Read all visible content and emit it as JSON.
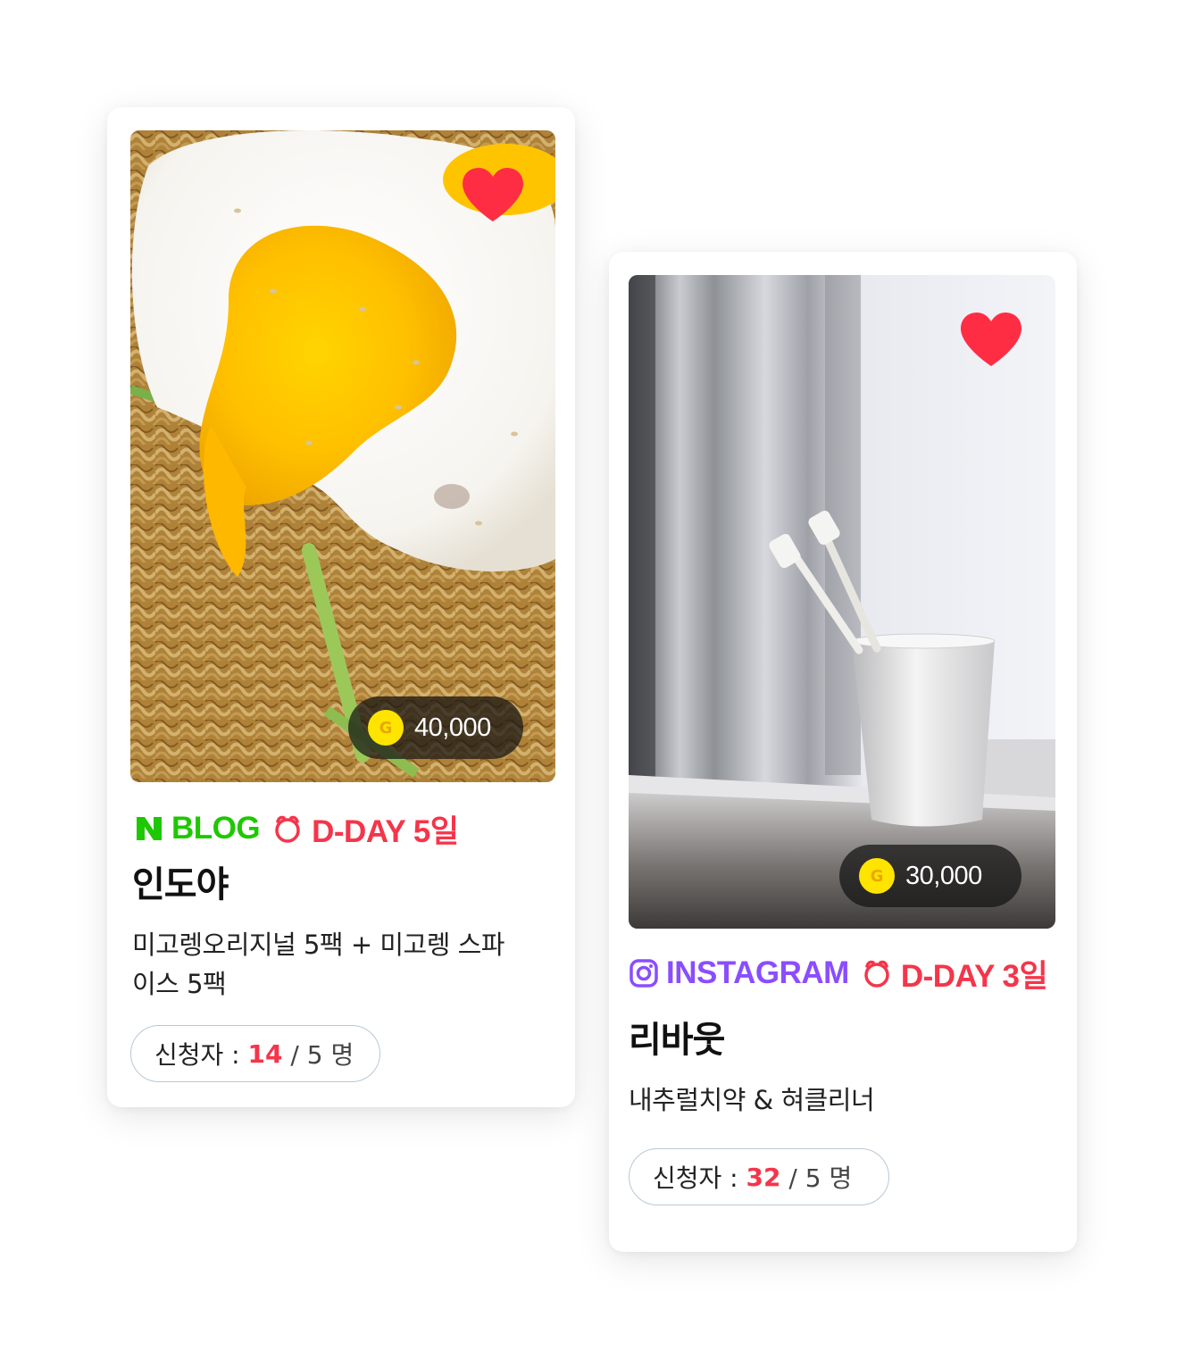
{
  "cards": [
    {
      "platform": "BLOG",
      "dday": "D-DAY 5일",
      "price": "40,000",
      "coin_label": "G",
      "title": "인도야",
      "description": "미고렝오리지널 5팩 + 미고렝 스파이스 5팩",
      "applicants_label": "신청자 :",
      "applicants_count": "14",
      "applicants_total": "/ 5 명",
      "platform_color": "#1ec800",
      "icons": [
        "naver-blog-icon",
        "heart-icon",
        "coin-icon",
        "alarm-clock-icon"
      ]
    },
    {
      "platform": "INSTAGRAM",
      "dday": "D-DAY 3일",
      "price": "30,000",
      "coin_label": "G",
      "title": "리바웃",
      "description": "내추럴치약 & 혀클리너",
      "applicants_label": "신청자 :",
      "applicants_count": "32",
      "applicants_total": "/ 5 명",
      "platform_color": "#8a4dff",
      "icons": [
        "instagram-icon",
        "heart-icon",
        "coin-icon",
        "alarm-clock-icon"
      ]
    }
  ],
  "colors": {
    "heart": "#ff2d44",
    "dday": "#f5354a",
    "count_highlight": "#f5354a",
    "coin": "#ffe400"
  }
}
